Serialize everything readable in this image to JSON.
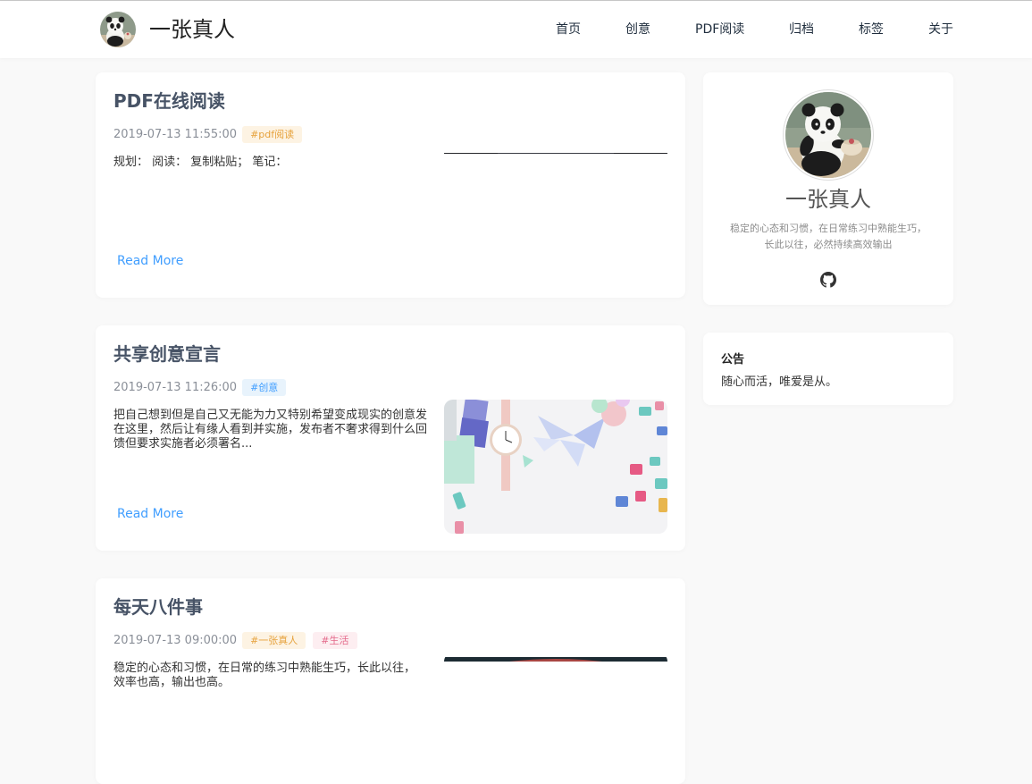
{
  "site": {
    "title": "一张真人"
  },
  "nav": {
    "items": [
      {
        "label": "首页"
      },
      {
        "label": "创意"
      },
      {
        "label": "PDF阅读"
      },
      {
        "label": "归档"
      },
      {
        "label": "标签"
      },
      {
        "label": "关于"
      }
    ]
  },
  "posts": [
    {
      "title": "PDF在线阅读",
      "date": "2019-07-13 11:55:00",
      "tags": [
        "#pdf阅读"
      ],
      "excerpt": "规划：  阅读：  复制粘贴；  笔记：",
      "read_more": "Read More"
    },
    {
      "title": "共享创意宣言",
      "date": "2019-07-13 11:26:00",
      "tags": [
        "#创意"
      ],
      "excerpt": "把自己想到但是自己又无能为力又特别希望变成现实的创意发在这里，然后让有缘人看到并实施，发布者不奢求得到什么回馈但要求实施者必须署名...",
      "read_more": "Read More"
    },
    {
      "title": "每天八件事",
      "date": "2019-07-13 09:00:00",
      "tags": [
        "#一张真人",
        "#生活"
      ],
      "excerpt": "稳定的心态和习惯，在日常的练习中熟能生巧，长此以往，效率也高，输出也高。"
    }
  ],
  "profile": {
    "name": "一张真人",
    "desc_line1": "稳定的心态和习惯，在日常练习中熟能生巧，",
    "desc_line2": "长此以往，必然持续高效输出",
    "link_icon": "github-icon"
  },
  "notice": {
    "title": "公告",
    "text": "随心而活，唯爱是从。"
  },
  "colors": {
    "accent": "#409eff",
    "tag_orange": "#e6a23c",
    "tag_blue": "#409eff",
    "tag_pink": "#e46a8b",
    "background": "#f9f9f9"
  }
}
